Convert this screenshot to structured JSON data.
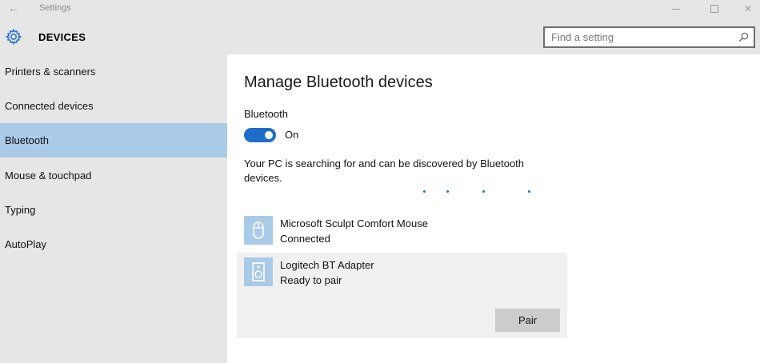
{
  "window": {
    "title": "Settings",
    "back_icon": "back-arrow-icon",
    "minimize_icon": "minimize-icon",
    "maximize_icon": "maximize-icon",
    "close_icon": "close-icon"
  },
  "header": {
    "section_title": "DEVICES",
    "section_icon": "gear-icon",
    "accent_color": "#1e6ec8",
    "search": {
      "placeholder": "Find a setting",
      "value": "",
      "icon": "search-icon"
    }
  },
  "sidebar": {
    "selected_color": "#a9cbe8",
    "items": [
      {
        "label": "Printers & scanners",
        "selected": false
      },
      {
        "label": "Connected devices",
        "selected": false
      },
      {
        "label": "Bluetooth",
        "selected": true
      },
      {
        "label": "Mouse & touchpad",
        "selected": false
      },
      {
        "label": "Typing",
        "selected": false
      },
      {
        "label": "AutoPlay",
        "selected": false
      }
    ]
  },
  "main": {
    "title": "Manage Bluetooth devices",
    "bluetooth_label": "Bluetooth",
    "toggle": {
      "state_label": "On",
      "on": true
    },
    "search_message": "Your PC is searching for and can be discovered by Bluetooth devices.",
    "devices": [
      {
        "name": "Microsoft Sculpt Comfort Mouse",
        "status": "Connected",
        "icon": "mouse-icon"
      },
      {
        "name": "Logitech BT Adapter",
        "status": "Ready to pair",
        "icon": "speaker-icon",
        "action_label": "Pair"
      }
    ]
  }
}
